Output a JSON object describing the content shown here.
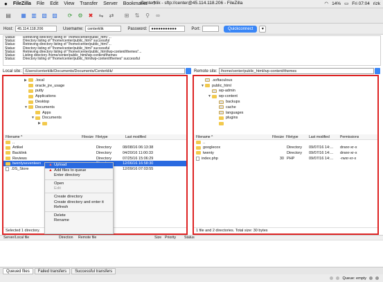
{
  "menubar": {
    "app": "FileZilla",
    "items": [
      "File",
      "Edit",
      "View",
      "Transfer",
      "Server",
      "Bookmarks",
      "?"
    ],
    "window_title": "Centerklik - sftp://center@45.114.118.206 - FileZilla",
    "battery": "14%",
    "clock": "Fri 07:04",
    "user": "rizk"
  },
  "quickconnect": {
    "host_label": "Host:",
    "host_value": "45.114.118.206",
    "username_label": "Username:",
    "username_value": "centerklik",
    "password_label": "Password:",
    "password_value": "●●●●●●●●●●●",
    "port_label": "Port:",
    "port_value": "",
    "connect_label": "Quickconnect",
    "dropdown_glyph": "▾"
  },
  "log": [
    {
      "s": "Status:",
      "m": "Retrieving directory listing of \"/home/center/public_html\"..."
    },
    {
      "s": "Status:",
      "m": "Directory listing of \"/home/center/public_html\" successful"
    },
    {
      "s": "Status:",
      "m": "Retrieving directory listing of \"/home/center/public_html\"..."
    },
    {
      "s": "Status:",
      "m": "Directory listing of \"/home/center/public_html\" successful"
    },
    {
      "s": "Status:",
      "m": "Retrieving directory listing of \"/home/center/public_html/wp-content/themes\"..."
    },
    {
      "s": "Status:",
      "m": "Listing directory /home/center/public_html/wp-content/themes"
    },
    {
      "s": "Status:",
      "m": "Directory listing of \"/home/center/public_html/wp-content/themes\" successful"
    }
  ],
  "local": {
    "site_label": "Local site:",
    "path": "/Users/centerklik/Documents/Documents/Centerklik/",
    "tree": [
      {
        "label": ".local",
        "indent": 3,
        "tri": "▶"
      },
      {
        "label": "oracle_jre_usage",
        "indent": 3,
        "tri": ""
      },
      {
        "label": "putty",
        "indent": 3,
        "tri": ""
      },
      {
        "label": "Applications",
        "indent": 3,
        "tri": ""
      },
      {
        "label": "Desktop",
        "indent": 3,
        "tri": ""
      },
      {
        "label": "Documents",
        "indent": 3,
        "tri": "▼"
      },
      {
        "label": "Apps",
        "indent": 4,
        "tri": ""
      },
      {
        "label": "Documents",
        "indent": 4,
        "tri": "▼"
      },
      {
        "label": "",
        "indent": 5,
        "tri": "▶"
      }
    ],
    "columns": [
      "Filename ^",
      "Filesize",
      "Filetype",
      "Last modified"
    ],
    "rows": [
      {
        "name": "..",
        "size": "",
        "type": "",
        "modified": "",
        "kind": "folder"
      },
      {
        "name": "Artikel",
        "size": "",
        "type": "Directory",
        "modified": "08/08/16 06:13:38",
        "kind": "folder"
      },
      {
        "name": "Backlink",
        "size": "",
        "type": "Directory",
        "modified": "04/20/16 11:00:33",
        "kind": "folder"
      },
      {
        "name": "Reviews",
        "size": "",
        "type": "Directory",
        "modified": "07/25/16 15:06:29",
        "kind": "folder"
      },
      {
        "name": "twentyseventeen",
        "size": "",
        "type": "Directory",
        "modified": "12/06/16 16:58:30",
        "kind": "folder",
        "selected": true
      },
      {
        "name": ".DS_Store",
        "size": "",
        "type": "",
        "modified": "12/09/16 07:03:55",
        "kind": "file"
      }
    ],
    "status": "Selected 1 directory."
  },
  "remote": {
    "site_label": "Remote site:",
    "path": "/home/center/public_html/wp-content/themes",
    "tree": [
      {
        "label": ".softaculous",
        "indent": 1,
        "tri": "",
        "q": true
      },
      {
        "label": "public_html",
        "indent": 1,
        "tri": "▼",
        "q": false
      },
      {
        "label": "wp-admin",
        "indent": 2,
        "tri": "",
        "q": true
      },
      {
        "label": "wp-content",
        "indent": 2,
        "tri": "▼",
        "q": false
      },
      {
        "label": "backups",
        "indent": 3,
        "tri": "",
        "q": true
      },
      {
        "label": "cache",
        "indent": 3,
        "tri": "",
        "q": true
      },
      {
        "label": "languages",
        "indent": 3,
        "tri": "",
        "q": true
      },
      {
        "label": "plugins",
        "indent": 3,
        "tri": "",
        "q": false
      },
      {
        "label": "",
        "indent": 3,
        "tri": "",
        "q": false
      }
    ],
    "columns": [
      "Filename ^",
      "Filesize",
      "Filetype",
      "Last modified",
      "Permissions"
    ],
    "rows": [
      {
        "name": "..",
        "size": "",
        "type": "",
        "modified": "",
        "perm": "",
        "kind": "folder"
      },
      {
        "name": "googlecox",
        "size": "",
        "type": "Directory",
        "modified": "09/07/16 14:...",
        "perm": "drwxr-xr-x",
        "kind": "folder"
      },
      {
        "name": "twenty",
        "size": "",
        "type": "Directory",
        "modified": "09/07/16 14:...",
        "perm": "drwxr-xr-x",
        "kind": "folder"
      },
      {
        "name": "index.php",
        "size": "30",
        "type": "PHP",
        "modified": "09/07/16 14:...",
        "perm": "-rwxr-xr-x",
        "kind": "file"
      }
    ],
    "status": "1 file and 2 directories. Total size: 30 bytes"
  },
  "context_menu": [
    {
      "label": "Upload",
      "state": "highlight",
      "icon": "upload-icon"
    },
    {
      "label": "Add files to queue",
      "state": "normal",
      "icon": "add-queue-icon"
    },
    {
      "label": "Enter directory",
      "state": "normal"
    },
    {
      "divider": true
    },
    {
      "label": "Open",
      "state": "normal"
    },
    {
      "label": "Edit",
      "state": "disabled"
    },
    {
      "divider": true
    },
    {
      "label": "Create directory",
      "state": "normal"
    },
    {
      "label": "Create directory and enter it",
      "state": "normal"
    },
    {
      "label": "Refresh",
      "state": "normal"
    },
    {
      "divider": true
    },
    {
      "label": "Delete",
      "state": "normal"
    },
    {
      "label": "Rename",
      "state": "normal"
    }
  ],
  "queue": {
    "columns": [
      "Server/Local file",
      "Direction",
      "Remote file",
      "Size",
      "Priority",
      "Status"
    ]
  },
  "tabs": [
    "Queued files",
    "Failed transfers",
    "Successful transfers"
  ],
  "bottom": {
    "queue_label": "Queue: empty"
  },
  "colors": {
    "accent": "#3a86f6",
    "selection": "#2a6ae0",
    "highlight_box": "#d22222",
    "folder": "#f2c94c"
  }
}
